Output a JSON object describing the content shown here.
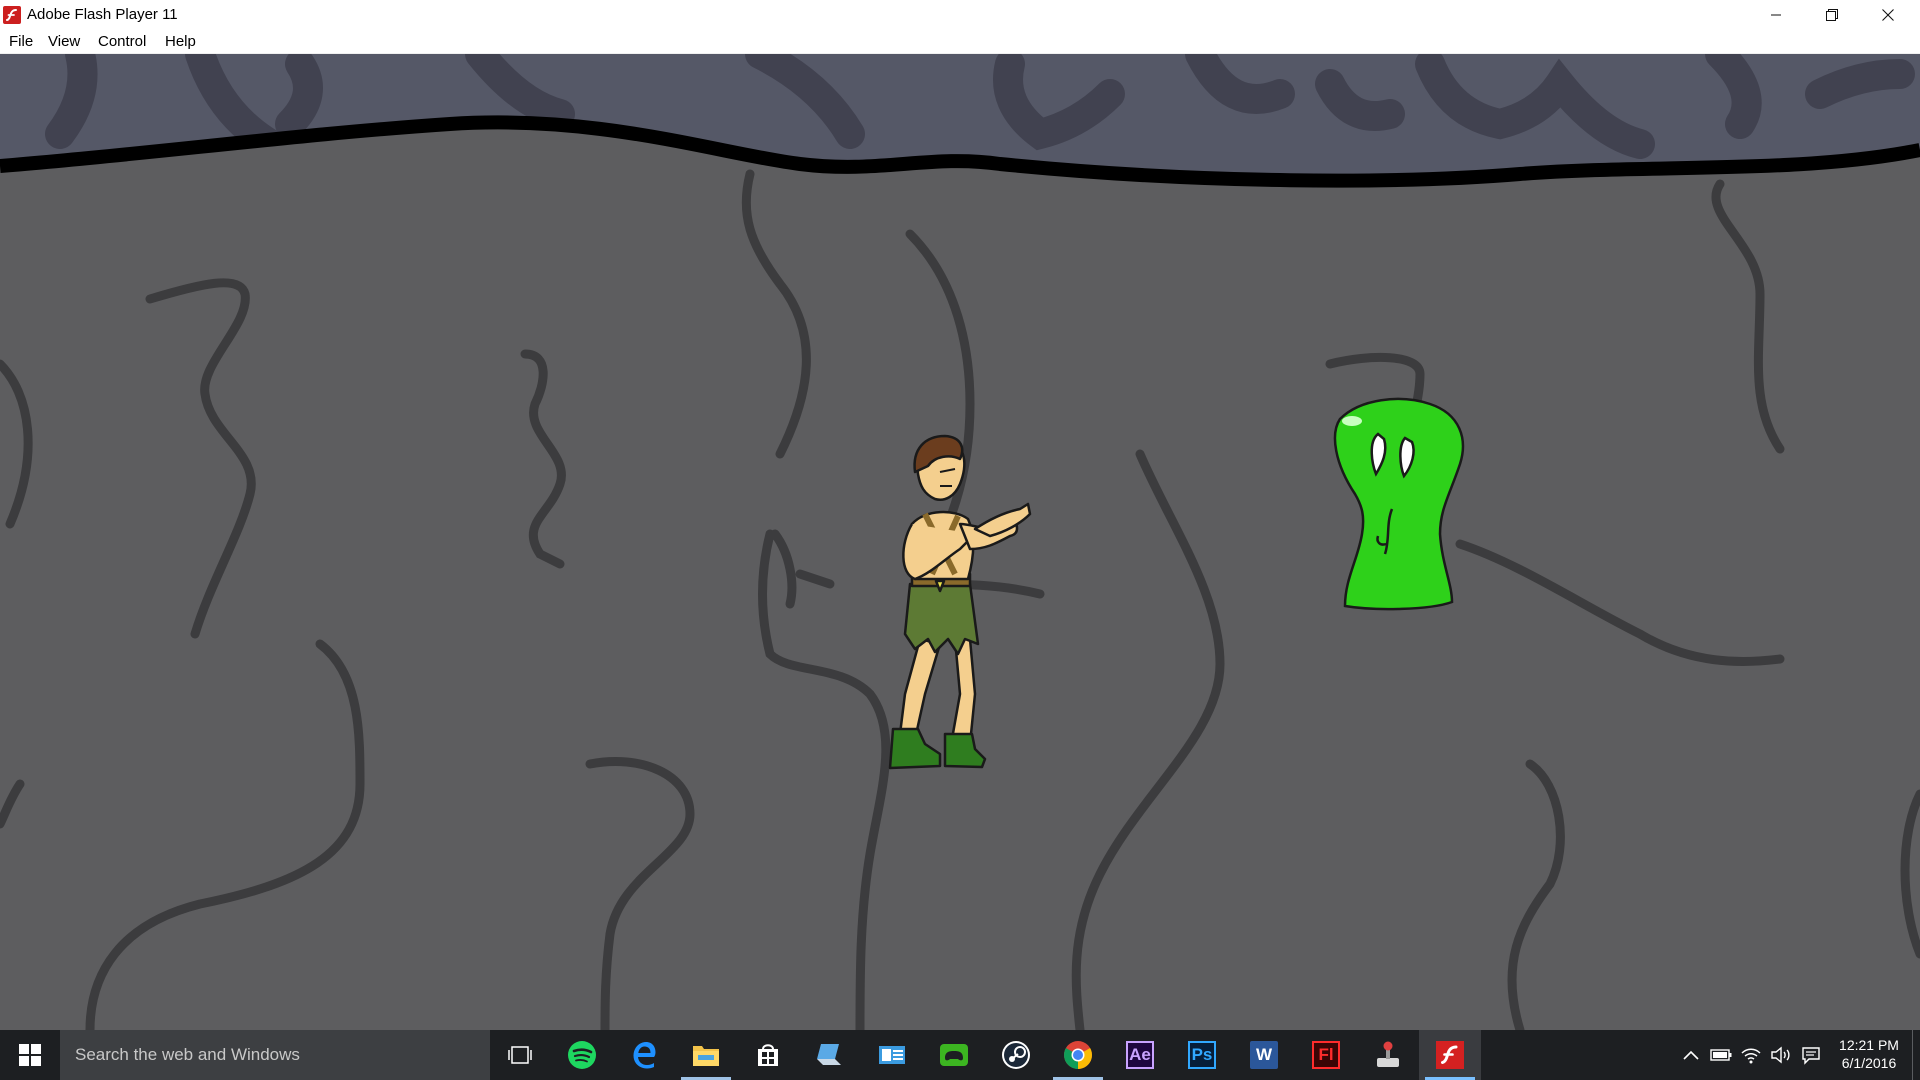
{
  "window": {
    "title": "Adobe Flash Player 11",
    "app_icon": "flash-player-icon",
    "controls": [
      "minimize-icon",
      "restore-icon",
      "close-icon"
    ]
  },
  "menu": {
    "items": [
      "File",
      "View",
      "Control",
      "Help"
    ]
  },
  "stage": {
    "colors": {
      "ceiling": "#555867",
      "wall": "#5d5d5f",
      "crack": "#3c3c3e",
      "slime": "#2ed11a",
      "outline": "#000000"
    },
    "player": "barbarian-fighter",
    "enemy": "green-slime-monster"
  },
  "taskbar": {
    "start_icon": "windows-logo-icon",
    "search_placeholder": "Search the web and Windows",
    "apps": [
      {
        "name": "task-view",
        "icon": "task-view-icon"
      },
      {
        "name": "spotify",
        "icon": "spotify-icon"
      },
      {
        "name": "edge",
        "icon": "edge-icon"
      },
      {
        "name": "file-explorer",
        "icon": "folder-icon"
      },
      {
        "name": "store",
        "icon": "store-icon"
      },
      {
        "name": "network-app",
        "icon": "laptop-icon"
      },
      {
        "name": "outlook",
        "icon": "mail-icon"
      },
      {
        "name": "razer-cortex",
        "icon": "gamepad-icon"
      },
      {
        "name": "steam",
        "icon": "steam-icon"
      },
      {
        "name": "chrome",
        "icon": "chrome-icon"
      },
      {
        "name": "after-effects",
        "icon": "after-effects-icon",
        "label": "Ae"
      },
      {
        "name": "photoshop",
        "icon": "photoshop-icon",
        "label": "Ps"
      },
      {
        "name": "word",
        "icon": "word-icon",
        "label": "W"
      },
      {
        "name": "flash-pro",
        "icon": "flash-pro-icon",
        "label": "Fl"
      },
      {
        "name": "game-controller",
        "icon": "joystick-icon"
      },
      {
        "name": "flash-player",
        "icon": "flash-player-icon"
      }
    ],
    "tray_icons": [
      "chevron-up-icon",
      "battery-icon",
      "wifi-icon",
      "volume-icon",
      "notification-icon"
    ],
    "clock": {
      "time": "12:21 PM",
      "date": "6/1/2016"
    }
  }
}
